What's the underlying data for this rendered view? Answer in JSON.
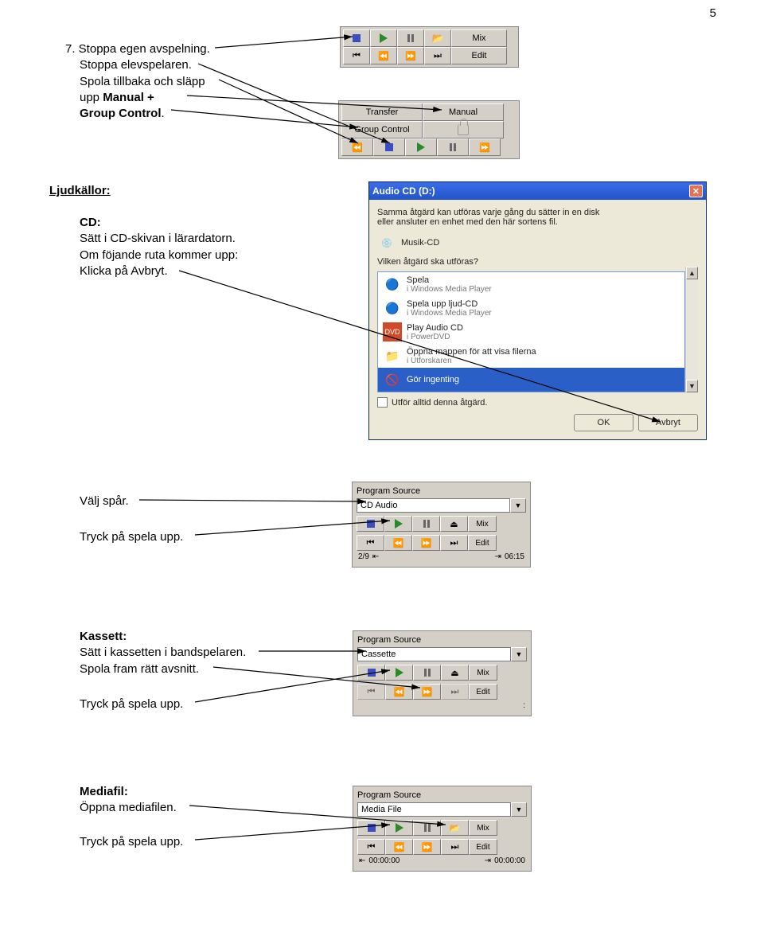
{
  "page_number": "5",
  "instr": {
    "step7_a": "7. Stoppa egen avspelning.",
    "step7_b": "Stoppa elevspelaren.",
    "step7_c": "Spola tillbaka och släpp",
    "step7_d": "upp ",
    "step7_d2": "Manual + ",
    "step7_e": "Group Control",
    "step7_f": ".",
    "ljudkallor": "Ljudkällor:",
    "cd": "CD:",
    "cd1": "Sätt i CD-skivan i lärardatorn.",
    "cd2": "Om föjande ruta kommer upp:",
    "cd3": "Klicka på Avbryt.",
    "valj": "Välj spår.",
    "tryck_spela1": "Tryck på spela upp.",
    "kassett": "Kassett:",
    "kas1": "Sätt i kassetten i bandspelaren.",
    "kas2": "Spola fram rätt avsnitt.",
    "tryck_spela2": "Tryck på spela upp.",
    "mediafil": "Mediafil:",
    "med1": "Öppna mediafilen.",
    "tryck_spela3": "Tryck på spela upp."
  },
  "toolbar1": {
    "mix": "Mix",
    "edit": "Edit"
  },
  "toolbar2": {
    "transfer": "Transfer",
    "manual": "Manual",
    "group": "Group Control"
  },
  "dialog": {
    "title": "Audio CD (D:)",
    "intro1": "Samma åtgärd kan utföras varje gång du sätter in en disk",
    "intro2": "eller ansluter en enhet med den här sortens fil.",
    "musik": "Musik-CD",
    "q": "Vilken åtgärd ska utföras?",
    "opt1a": "Spela",
    "opt1b": "i Windows Media Player",
    "opt2a": "Spela upp ljud-CD",
    "opt2b": "i Windows Media Player",
    "opt3a": "Play Audio CD",
    "opt3b": "i PowerDVD",
    "opt4a": "Öppna mappen för att visa filerna",
    "opt4b": "i Utforskaren",
    "opt5": "Gör ingenting",
    "check": "Utför alltid denna åtgärd.",
    "ok": "OK",
    "avbryt": "Avbryt"
  },
  "ps1": {
    "label": "Program Source",
    "value": "CD Audio",
    "mix": "Mix",
    "edit": "Edit",
    "track": "2/9",
    "time": "06:15"
  },
  "ps2": {
    "label": "Program Source",
    "value": "Cassette",
    "mix": "Mix",
    "edit": "Edit",
    "time": ":"
  },
  "ps3": {
    "label": "Program Source",
    "value": "Media File",
    "mix": "Mix",
    "edit": "Edit",
    "t1": "00:00:00",
    "t2": "00:00:00"
  }
}
